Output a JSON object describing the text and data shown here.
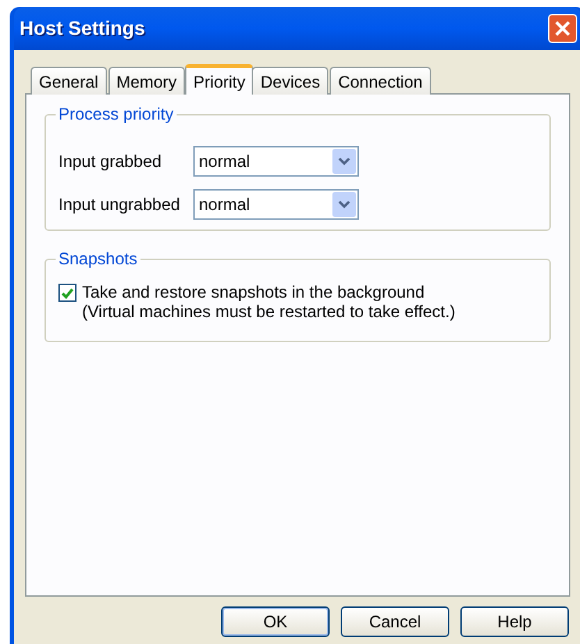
{
  "window": {
    "title": "Host Settings"
  },
  "tabs": [
    {
      "label": "General",
      "selected": false
    },
    {
      "label": "Memory",
      "selected": false
    },
    {
      "label": "Priority",
      "selected": true
    },
    {
      "label": "Devices",
      "selected": false
    },
    {
      "label": "Connection",
      "selected": false
    }
  ],
  "process_priority": {
    "title": "Process priority",
    "rows": [
      {
        "label": "Input grabbed",
        "value": "normal"
      },
      {
        "label": "Input ungrabbed",
        "value": "normal"
      }
    ]
  },
  "snapshots": {
    "title": "Snapshots",
    "checkbox": {
      "label": "Take and restore snapshots in the background",
      "note": "(Virtual machines must be restarted to take effect.)",
      "checked": true
    }
  },
  "buttons": [
    "OK",
    "Cancel",
    "Help"
  ]
}
